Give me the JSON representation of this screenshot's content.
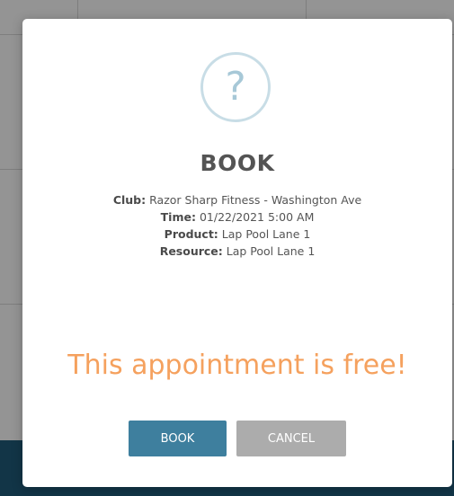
{
  "modal": {
    "icon": "question-icon",
    "icon_glyph": "?",
    "title": "BOOK",
    "details": [
      {
        "label": "Club:",
        "value": "Razor Sharp Fitness - Washington Ave"
      },
      {
        "label": "Time:",
        "value": "01/22/2021 5:00 AM"
      },
      {
        "label": "Product:",
        "value": "Lap Pool Lane 1"
      },
      {
        "label": "Resource:",
        "value": "Lap Pool Lane 1"
      }
    ],
    "message": "This appointment is free!",
    "buttons": {
      "book_label": "BOOK",
      "cancel_label": "CANCEL"
    }
  },
  "colors": {
    "primary_button": "#3e7f9e",
    "secondary_button": "#acacac",
    "message": "#f5a15e",
    "icon": "#a7c8d7"
  }
}
